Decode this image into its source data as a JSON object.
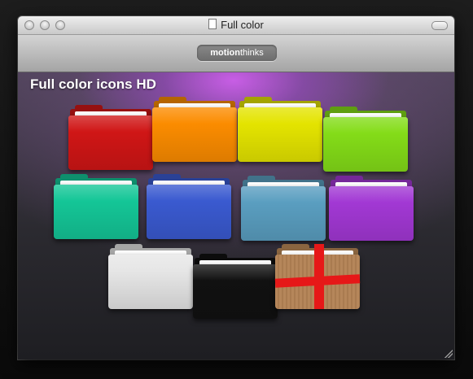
{
  "window": {
    "title": "Full color"
  },
  "toolbar": {
    "brand_bold": "motion",
    "brand_light": "thinks"
  },
  "content": {
    "heading": "Full color icons HD"
  },
  "folders": [
    {
      "name": "red-folder-icon",
      "color": "#d01616"
    },
    {
      "name": "orange-folder-icon",
      "color": "#fb8c00"
    },
    {
      "name": "yellow-folder-icon",
      "color": "#e4e400"
    },
    {
      "name": "lime-folder-icon",
      "color": "#84dc18"
    },
    {
      "name": "teal-folder-icon",
      "color": "#14c697"
    },
    {
      "name": "blue-folder-icon",
      "color": "#3a5ad0"
    },
    {
      "name": "steel-blue-folder-icon",
      "color": "#5a9ec0"
    },
    {
      "name": "purple-folder-icon",
      "color": "#a238d4"
    },
    {
      "name": "white-folder-icon",
      "color": "#e6e6e6"
    },
    {
      "name": "black-folder-icon",
      "color": "#111111"
    },
    {
      "name": "cardboard-box-folder-icon",
      "color": "#b88c5c"
    }
  ]
}
